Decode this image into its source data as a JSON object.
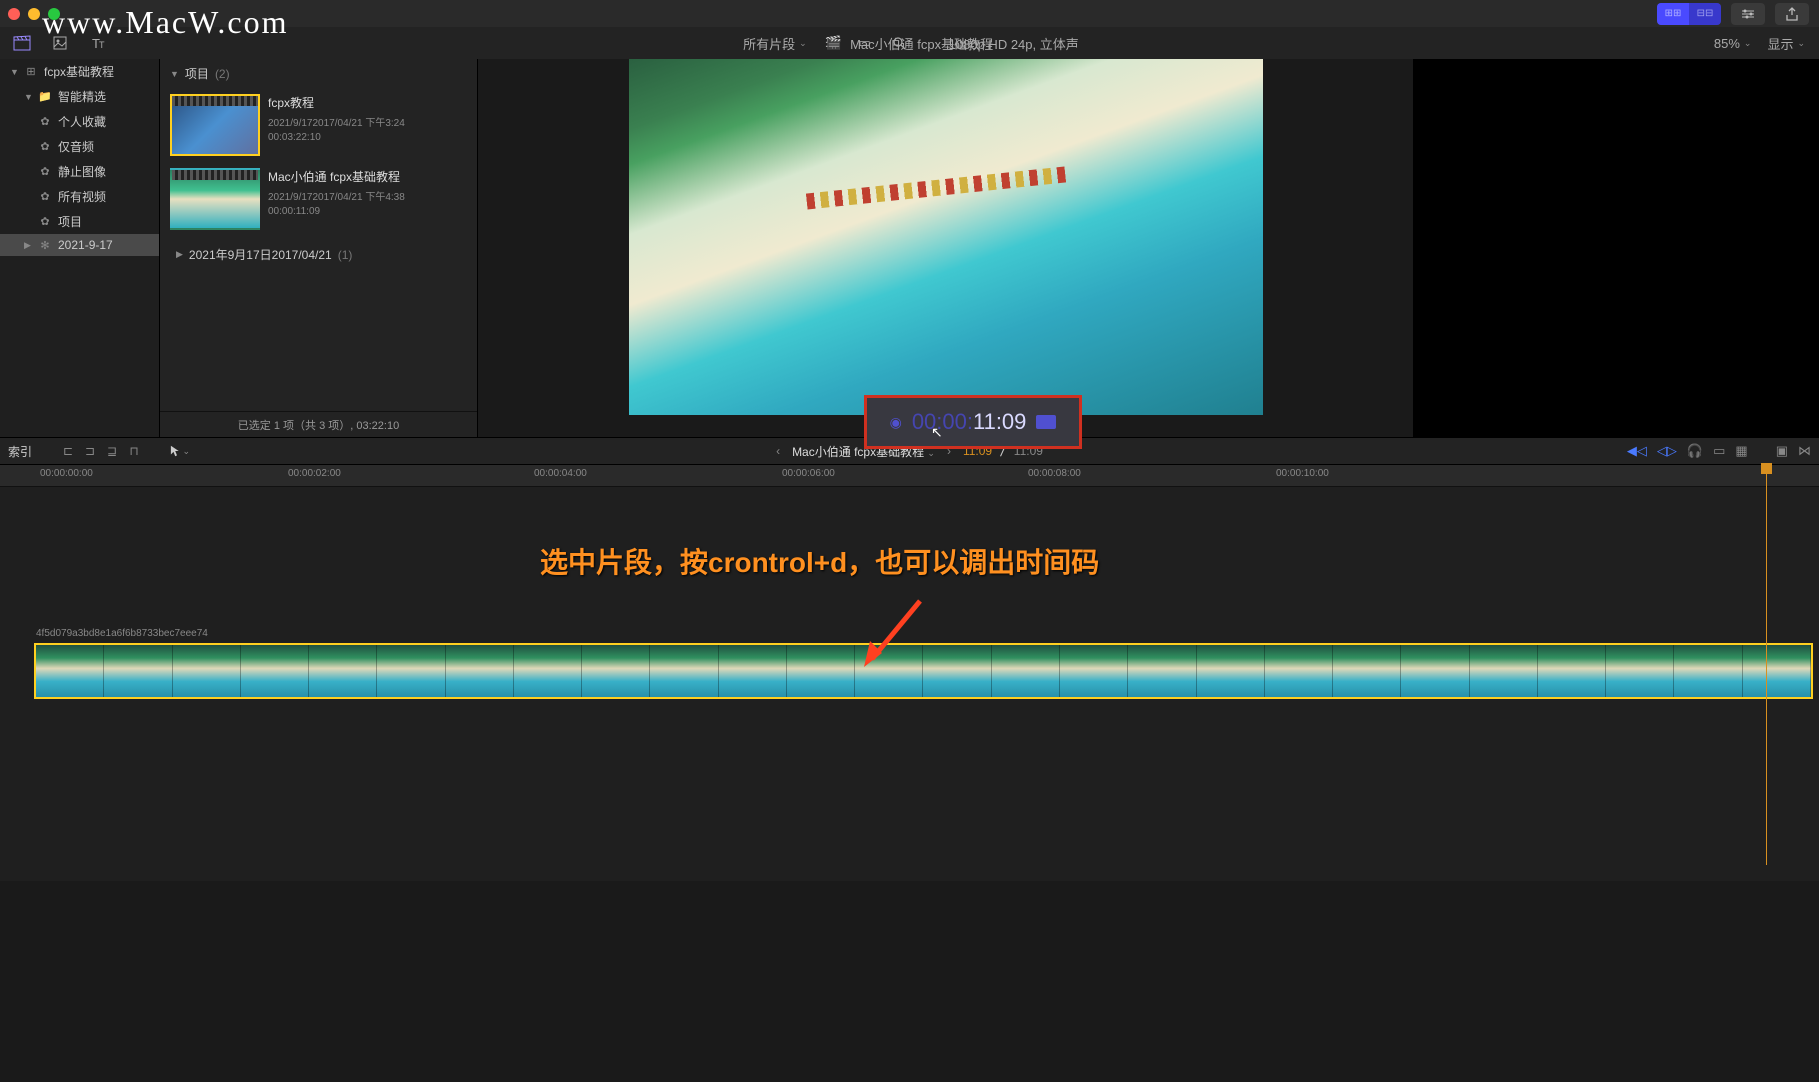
{
  "watermark": "www.MacW.com",
  "titlebar": {
    "inspector_icon": "⚙",
    "share_icon": "⬆"
  },
  "toolbar": {
    "clips_filter": "所有片段",
    "format": "1080p HD 24p, 立体声",
    "project_name": "Mac小伯通 fcpx基础教程",
    "zoom": "85%",
    "display_label": "显示"
  },
  "sidebar": {
    "library": "fcpx基础教程",
    "smart": "智能精选",
    "items": [
      "个人收藏",
      "仅音频",
      "静止图像",
      "所有视频",
      "项目"
    ],
    "event": "2021-9-17"
  },
  "browser": {
    "header": "项目",
    "header_count": "(2)",
    "clip1": {
      "title": "fcpx教程",
      "date": "2021/9/172017/04/21 下午3:24",
      "duration": "00:03:22:10"
    },
    "clip2": {
      "title": "Mac小伯通 fcpx基础教程",
      "date": "2021/9/172017/04/21 下午4:38",
      "duration": "00:00:11:09"
    },
    "date_group": "2021年9月17日2017/04/21",
    "date_count": "(1)",
    "footer": "已选定 1 项（共 3 项）, 03:22:10"
  },
  "timecode": {
    "prefix": "00:00:",
    "main": "11:09"
  },
  "timeline_toolbar": {
    "index_label": "索引",
    "project": "Mac小伯通 fcpx基础教程",
    "current": "11:09",
    "total": "11:09"
  },
  "ruler": {
    "marks": [
      "00:00:00:00",
      "00:00:02:00",
      "00:00:04:00",
      "00:00:06:00",
      "00:00:08:00",
      "00:00:10:00"
    ]
  },
  "timeline": {
    "annotation": "选中片段，按crontrol+d，也可以调出时间码",
    "clip_id": "4f5d079a3bd8e1a6f6b8733bec7eee74"
  }
}
